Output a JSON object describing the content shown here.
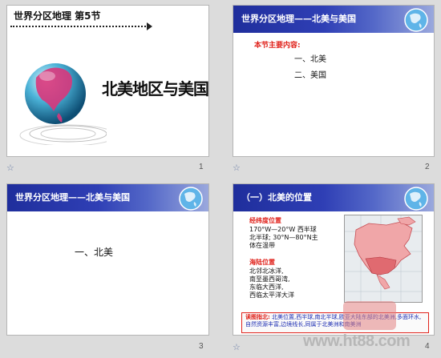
{
  "slides": [
    {
      "title": "世界分区地理 第5节",
      "heading": "北美地区与美国",
      "number": "1"
    },
    {
      "header": "世界分区地理——北美与美国",
      "subtitle": "本节主要内容:",
      "items": [
        "一、北美",
        "二、美国"
      ],
      "number": "2"
    },
    {
      "header": "世界分区地理——北美与美国",
      "items": [
        "一、北美"
      ],
      "number": "3"
    },
    {
      "header": "（一）北美的位置",
      "lat_lon_label": "经纬度位置",
      "lat_lon_text": [
        "170°W—20°W 西半球",
        "北半球; 30°N—80°N主",
        "体在温带"
      ],
      "sea_label": "海陆位置",
      "sea_text": [
        "北邻北冰洋,",
        "南至墨西哥湾,",
        "东临大西洋,",
        "西临太平洋大洋"
      ],
      "box_label": "读图指北:",
      "box_text": "北美位置,西半球,南北半球,欧亚大陆东部的北美洲,多面环水,自然资源丰富,边境线长,同属于北美洲和南美洲",
      "number": "4"
    }
  ],
  "watermark": "www.ht88.com",
  "star_glyph": "☆"
}
